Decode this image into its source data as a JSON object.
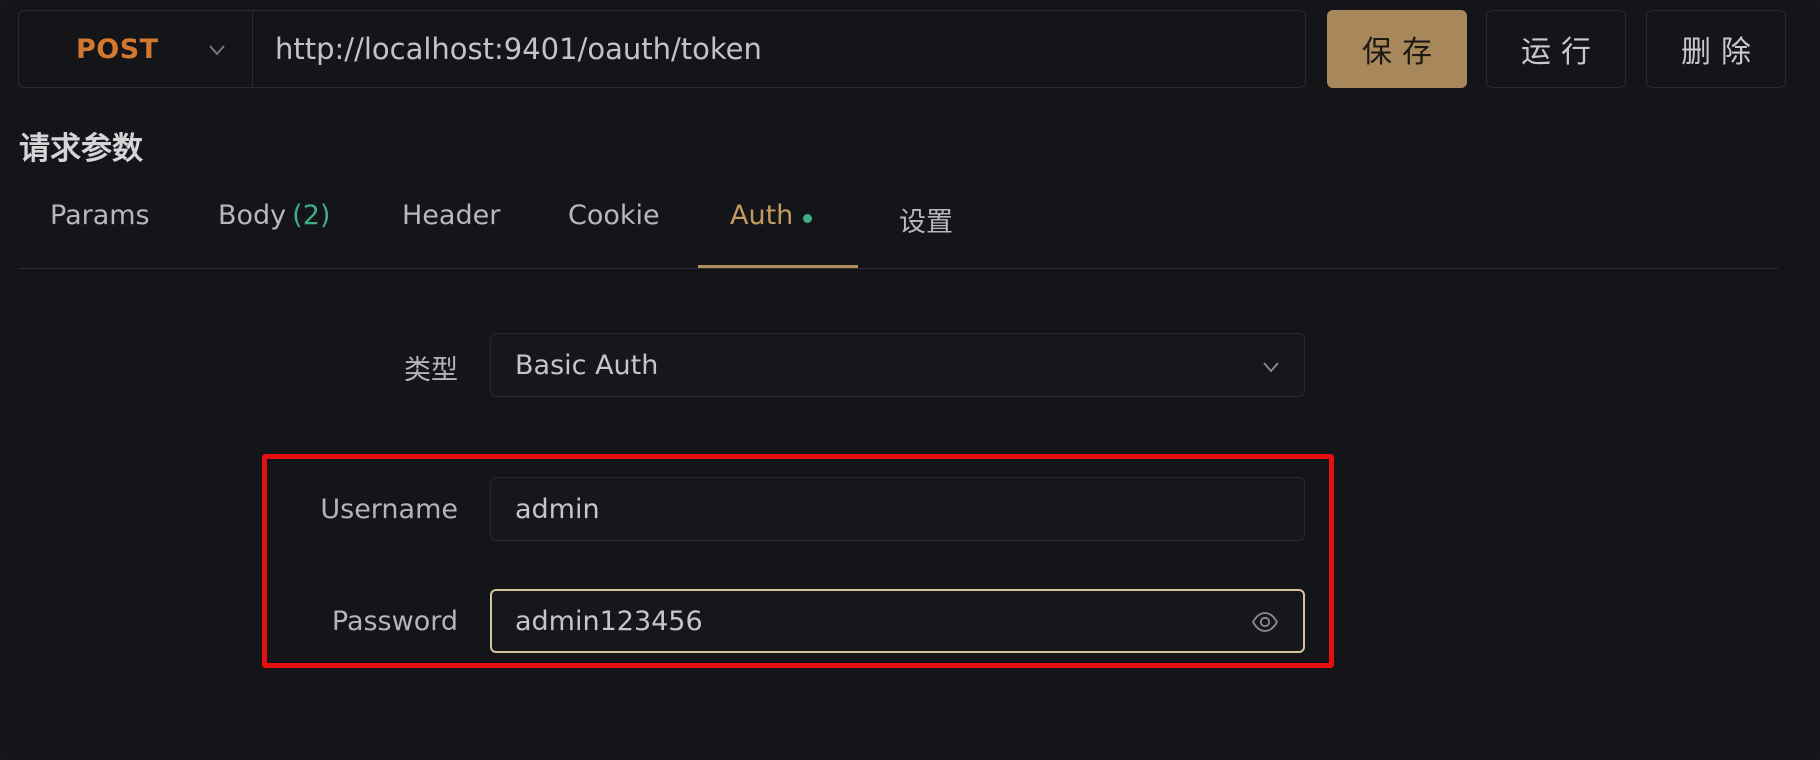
{
  "request": {
    "method": "POST",
    "url": "http://localhost:9401/oauth/token"
  },
  "actions": {
    "save": "保存",
    "run": "运行",
    "delete": "删除"
  },
  "section_title": "请求参数",
  "tabs": [
    {
      "label": "Params"
    },
    {
      "label": "Body",
      "count": "(2)"
    },
    {
      "label": "Header"
    },
    {
      "label": "Cookie"
    },
    {
      "label": "Auth",
      "active": true
    },
    {
      "label": "设置"
    }
  ],
  "auth": {
    "type_label": "类型",
    "type_value": "Basic Auth",
    "username_label": "Username",
    "username_value": "admin",
    "password_label": "Password",
    "password_value": "admin123456"
  },
  "colors": {
    "method": "#d4782f",
    "primary_button": "#a8875a",
    "active_tab": "#c49a5e",
    "indicator": "#3fae86",
    "highlight": "#e40f0f"
  }
}
